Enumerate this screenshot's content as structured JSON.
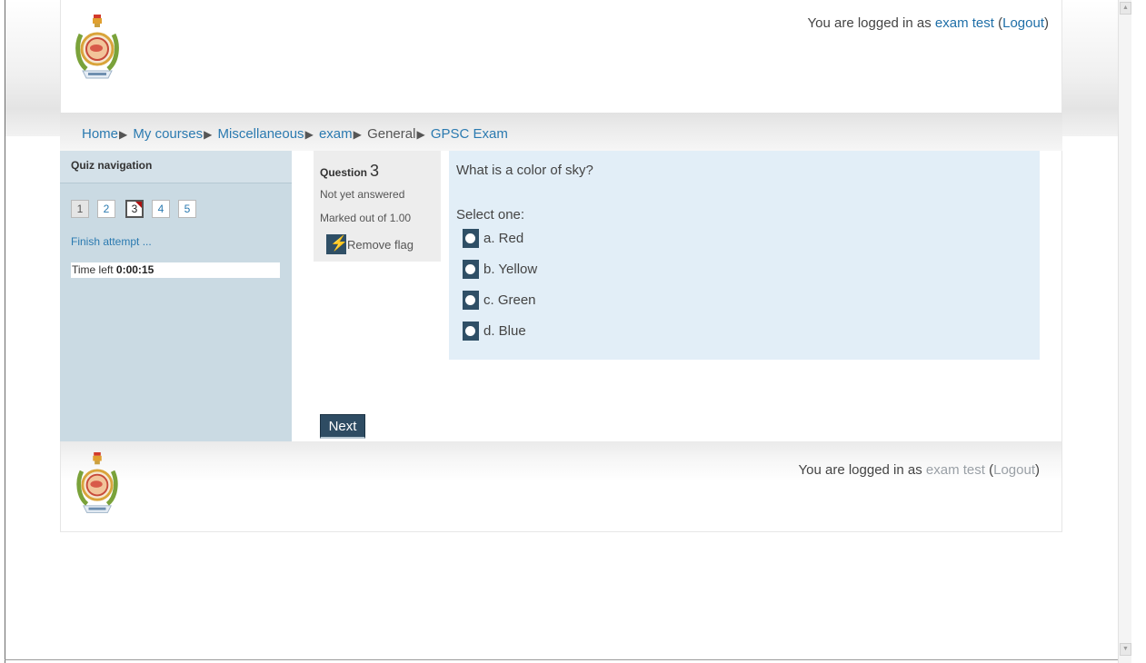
{
  "header": {
    "login_prefix": "You are logged in as ",
    "user_name": "exam test",
    "paren_open": " (",
    "logout": "Logout",
    "paren_close": ")"
  },
  "breadcrumb": [
    {
      "label": "Home",
      "link": true
    },
    {
      "label": "My courses",
      "link": true
    },
    {
      "label": "Miscellaneous",
      "link": true
    },
    {
      "label": "exam",
      "link": true
    },
    {
      "label": "General",
      "link": false
    },
    {
      "label": "GPSC Exam",
      "link": true
    }
  ],
  "quiz_nav": {
    "title": "Quiz navigation",
    "buttons": [
      "1",
      "2",
      "3",
      "4",
      "5"
    ],
    "finish_label": "Finish attempt ...",
    "time_label": "Time left ",
    "time_value": "0:00:15"
  },
  "question_info": {
    "label": "Question",
    "number": "3",
    "state": "Not yet answered",
    "grade": "Marked out of 1.00",
    "flag_label": "Remove flag"
  },
  "question": {
    "text": "What is a color of sky?",
    "prompt": "Select one:",
    "options": [
      "a. Red",
      "b. Yellow",
      "c. Green",
      "d. Blue"
    ]
  },
  "next_label": "Next",
  "footer": {
    "login_prefix": "You are logged in as ",
    "user_name": "exam test",
    "paren_open": " (",
    "logout": "Logout",
    "paren_close": ")"
  },
  "colors": {
    "link": "#2b7ab0",
    "sidebar_bg": "#cadae3",
    "formulation_bg": "#e2eef7",
    "button_dark": "#2e4c63",
    "flag_red": "#e81818"
  }
}
